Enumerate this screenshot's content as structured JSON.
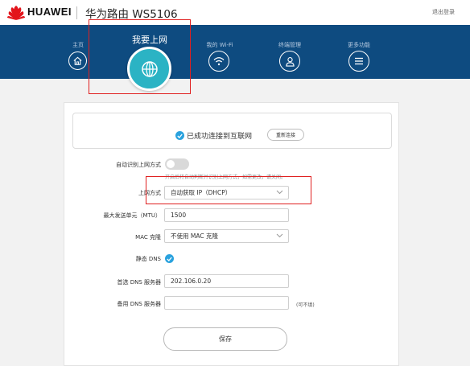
{
  "header": {
    "brand": "HUAWEI",
    "router_title": "华为路由 WS5106",
    "logout": "退出登录"
  },
  "nav": {
    "items": [
      {
        "label": "主页",
        "icon": "home-icon"
      },
      {
        "label": "我要上网",
        "icon": "globe-icon",
        "active": true
      },
      {
        "label": "我的 Wi-Fi",
        "icon": "wifi-icon"
      },
      {
        "label": "终端管理",
        "icon": "user-icon"
      },
      {
        "label": "更多功能",
        "icon": "menu-icon"
      }
    ]
  },
  "status": {
    "text": "已成功连接到互联网",
    "reconnect": "重新连接"
  },
  "form": {
    "auto_detect_label": "自动识别上网方式",
    "auto_detect_hint": "开启后将自动判断并识别上网方式，如需更改，请关闭。",
    "mode_label": "上网方式",
    "mode_value": "自动获取 IP（DHCP）",
    "mtu_label": "最大发送单元（MTU）",
    "mtu_value": "1500",
    "mac_label": "MAC 克隆",
    "mac_value": "不使用 MAC 克隆",
    "static_dns_label": "静态 DNS",
    "primary_dns_label": "首选 DNS 服务器",
    "primary_dns_value": "202.106.0.20",
    "secondary_dns_label": "备用 DNS 服务器",
    "secondary_dns_value": "",
    "optional": "(可不填)",
    "save": "保存"
  },
  "colors": {
    "nav_bg": "#0e4b80",
    "active_circle": "#2bb3c4",
    "accent": "#2aa2de",
    "highlight": "#e02020"
  }
}
